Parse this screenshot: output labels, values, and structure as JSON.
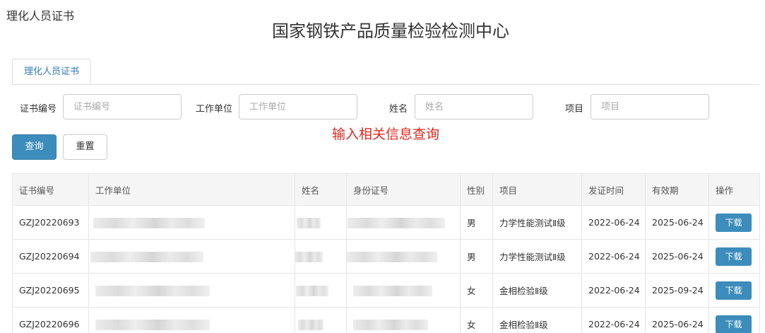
{
  "corner_title": "理化人员证书",
  "main_title": "国家钢铁产品质量检验检测中心",
  "tabs": [
    {
      "label": "理化人员证书",
      "active": true
    }
  ],
  "filters": {
    "cert_no": {
      "label": "证书编号",
      "placeholder": "证书编号",
      "value": ""
    },
    "work_unit": {
      "label": "工作单位",
      "placeholder": "工作单位",
      "value": ""
    },
    "name": {
      "label": "姓名",
      "placeholder": "姓名",
      "value": ""
    },
    "project": {
      "label": "项目",
      "placeholder": "项目",
      "value": ""
    }
  },
  "hint": "输入相关信息查询",
  "buttons": {
    "query": "查询",
    "reset": "重置"
  },
  "table": {
    "headers": [
      "证书编号",
      "工作单位",
      "姓名",
      "身份证号",
      "性别",
      "项目",
      "发证时间",
      "有效期",
      "操作"
    ],
    "download_label": "下载",
    "rows": [
      {
        "cert_no": "GZJ20220693",
        "gender": "男",
        "project": "力学性能测试Ⅱ级",
        "issue_date": "2022-06-24",
        "valid_until": "2025-06-24"
      },
      {
        "cert_no": "GZJ20220694",
        "gender": "男",
        "project": "力学性能测试Ⅱ级",
        "issue_date": "2022-06-24",
        "valid_until": "2025-06-24"
      },
      {
        "cert_no": "GZJ20220695",
        "gender": "女",
        "project": "金相检验Ⅱ级",
        "issue_date": "2022-06-24",
        "valid_until": "2025-09-24"
      },
      {
        "cert_no": "GZJ20220696",
        "gender": "女",
        "project": "金相检验Ⅱ级",
        "issue_date": "2022-06-24",
        "valid_until": "2025-06-24"
      }
    ]
  },
  "colors": {
    "primary": "#3c8dbc",
    "hint": "#e0281f",
    "tab_text": "#337ab7"
  }
}
